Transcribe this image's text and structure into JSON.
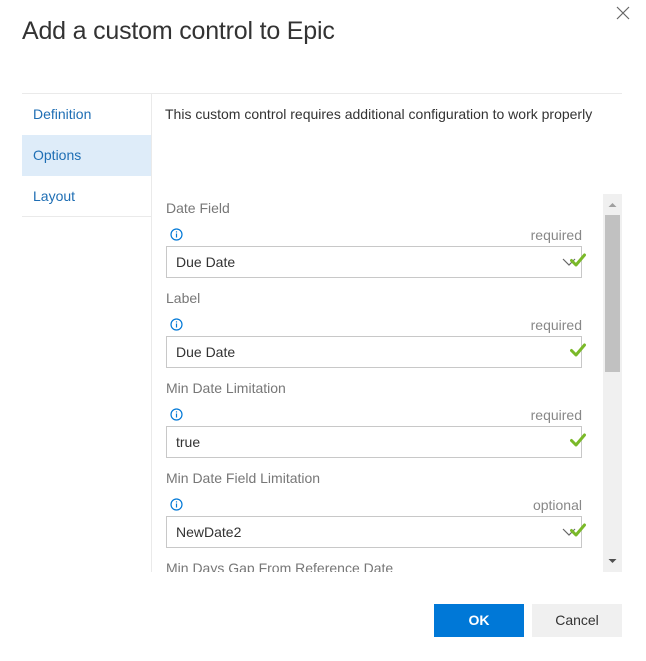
{
  "dialog": {
    "title": "Add a custom control to Epic",
    "close_icon": "close-icon"
  },
  "nav": {
    "items": [
      {
        "label": "Definition",
        "active": false
      },
      {
        "label": "Options",
        "active": true
      },
      {
        "label": "Layout",
        "active": false
      }
    ]
  },
  "main": {
    "notice": "This custom control requires additional configuration to work properly",
    "fields": [
      {
        "label": "Date Field",
        "requirement": "required",
        "value": "Due Date",
        "type": "dropdown",
        "valid": true
      },
      {
        "label": "Label",
        "requirement": "required",
        "value": "Due Date",
        "type": "text",
        "valid": true
      },
      {
        "label": "Min Date Limitation",
        "requirement": "required",
        "value": "true",
        "type": "text",
        "valid": true
      },
      {
        "label": "Min Date Field Limitation",
        "requirement": "optional",
        "value": "NewDate2",
        "type": "dropdown",
        "valid": true
      },
      {
        "label": "Min Days Gap From Reference Date"
      }
    ]
  },
  "colors": {
    "accent": "#0078d7",
    "nav_active_bg": "#deecf9",
    "link": "#1e6eb4",
    "valid_check": "#7ab929",
    "info": "#0078d7"
  },
  "footer": {
    "ok_label": "OK",
    "cancel_label": "Cancel"
  }
}
